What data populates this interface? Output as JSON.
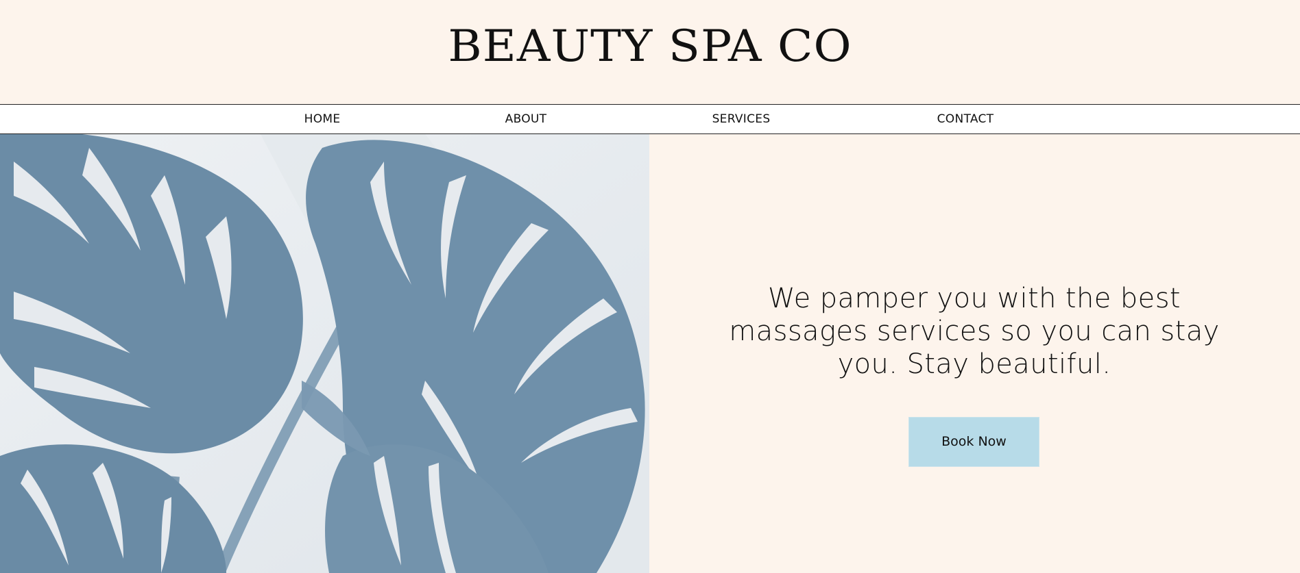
{
  "header": {
    "title": "BEAUTY SPA CO"
  },
  "nav": {
    "items": [
      {
        "label": "HOME"
      },
      {
        "label": "ABOUT"
      },
      {
        "label": "SERVICES"
      },
      {
        "label": "CONTACT"
      }
    ]
  },
  "hero": {
    "image_icon": "monstera-leaves-image",
    "tagline": "We pamper you with the best massages services so you can stay you. Stay beautiful.",
    "cta_label": "Book Now"
  },
  "colors": {
    "background": "#fdf4ec",
    "nav_background": "#ffffff",
    "button": "#b7dbe8",
    "leaf": "#6b8ca6",
    "image_background": "#e6eaee"
  }
}
